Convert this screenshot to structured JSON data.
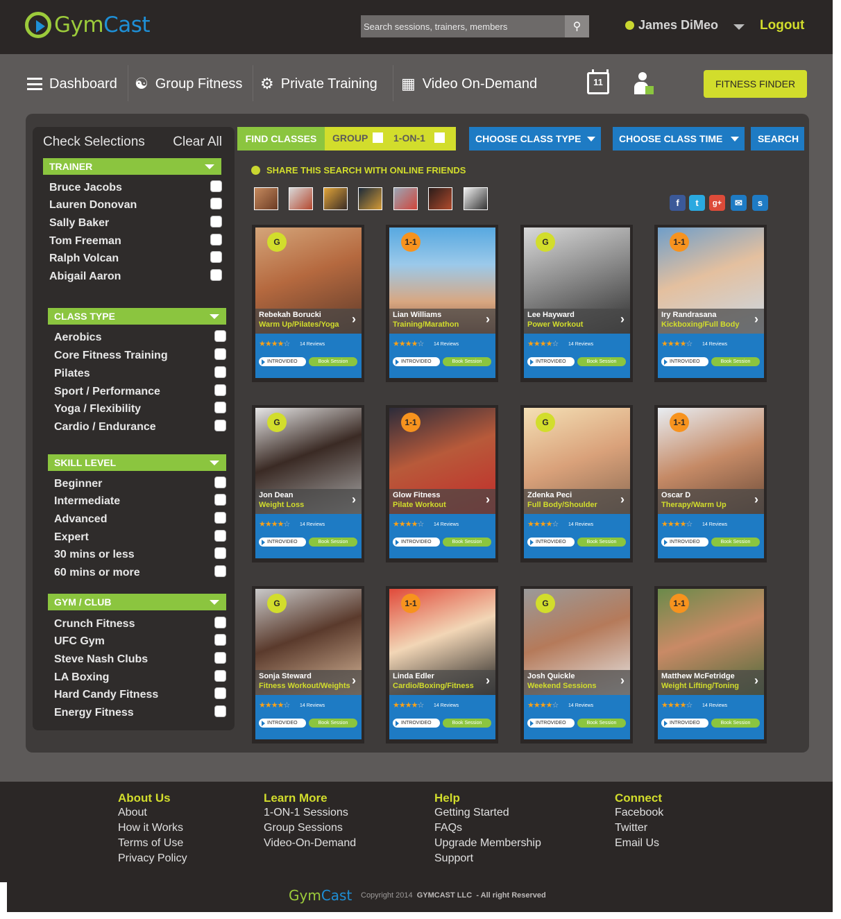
{
  "header": {
    "logo": {
      "part1": "Gym",
      "part2": "Cast"
    },
    "search_placeholder": "Search sessions, trainers, members",
    "user_name": "James DiMeo",
    "logout": "Logout"
  },
  "nav": {
    "items": [
      "Dashboard",
      "Group Fitness",
      "Private Training",
      "Video On-Demand"
    ],
    "calendar_day": "11",
    "fitness_finder": "FITNESS FINDER"
  },
  "sidebar": {
    "check_selections": "Check Selections",
    "clear_all": "Clear All",
    "sections": [
      {
        "title": "TRAINER",
        "options": [
          "Bruce Jacobs",
          "Lauren Donovan",
          "Sally Baker",
          "Tom Freeman",
          "Ralph Volcan",
          "Abigail Aaron"
        ]
      },
      {
        "title": "CLASS TYPE",
        "options": [
          "Aerobics",
          "Core Fitness Training",
          "Pilates",
          "Sport / Performance",
          "Yoga / Flexibility",
          "Cardio / Endurance"
        ]
      },
      {
        "title": "SKILL LEVEL",
        "options": [
          "Beginner",
          "Intermediate",
          "Advanced",
          "Expert",
          "30 mins or less",
          "60 mins or more"
        ]
      },
      {
        "title": "GYM / CLUB",
        "options": [
          "Crunch Fitness",
          "UFC Gym",
          "Steve Nash Clubs",
          "LA Boxing",
          "Hard Candy Fitness",
          "Energy Fitness"
        ]
      }
    ]
  },
  "toolbar": {
    "find_classes": "FIND CLASSES",
    "group": "GROUP",
    "one_on_one": "1-ON-1",
    "class_type": "CHOOSE CLASS TYPE",
    "class_time": "CHOOSE CLASS TIME",
    "search": "SEARCH"
  },
  "share": {
    "text": "SHARE THIS SEARCH WITH ONLINE FRIENDS"
  },
  "social": [
    "facebook-icon",
    "twitter-icon",
    "google-plus-icon",
    "email-icon",
    "skype-icon"
  ],
  "card_labels": {
    "reviews": "14 Reviews",
    "intro": "INTROVIDEO",
    "book": "Book Session"
  },
  "cards": [
    {
      "badge": "G",
      "name": "Rebekah Borucki",
      "class": "Warm Up/Pilates/Yoga",
      "rating": 4
    },
    {
      "badge": "1-1",
      "name": "Lian Williams",
      "class": "Training/Marathon",
      "rating": 4
    },
    {
      "badge": "G",
      "name": "Lee Hayward",
      "class": "Power Workout",
      "rating": 4
    },
    {
      "badge": "1-1",
      "name": "Iry Randrasana",
      "class": "Kickboxing/Full Body",
      "rating": 4
    },
    {
      "badge": "G",
      "name": "Jon Dean",
      "class": "Weight Loss",
      "rating": 4
    },
    {
      "badge": "1-1",
      "name": "Glow Fitness",
      "class": "Pilate Workout",
      "rating": 4
    },
    {
      "badge": "G",
      "name": "Zdenka Peci",
      "class": "Full Body/Shoulder",
      "rating": 4
    },
    {
      "badge": "1-1",
      "name": "Oscar D",
      "class": "Therapy/Warm Up",
      "rating": 4
    },
    {
      "badge": "G",
      "name": "Sonja Steward",
      "class": "Fitness Workout/Weights",
      "rating": 4
    },
    {
      "badge": "1-1",
      "name": "Linda Edler",
      "class": "Cardio/Boxing/Fitness",
      "rating": 4
    },
    {
      "badge": "G",
      "name": "Josh Quickle",
      "class": "Weekend Sessions",
      "rating": 4
    },
    {
      "badge": "1-1",
      "name": "Matthew McFetridge",
      "class": "Weight Lifting/Toning",
      "rating": 4
    }
  ],
  "footer": {
    "columns": [
      {
        "title": "About Us",
        "links": [
          "About",
          "How it Works",
          "Terms of Use",
          "Privacy Policy"
        ]
      },
      {
        "title": "Learn More",
        "links": [
          "1-ON-1 Sessions",
          "Group Sessions",
          "Video-On-Demand"
        ]
      },
      {
        "title": "Help",
        "links": [
          "Getting Started",
          "FAQs",
          "Upgrade Membership",
          "Support"
        ]
      },
      {
        "title": "Connect",
        "links": [
          "Facebook",
          "Twitter",
          "Email Us"
        ]
      }
    ],
    "copyright_prefix": "Copyright 2014",
    "copyright_company": "GYMCAST LLC",
    "copyright_suffix": "-  All right Reserved"
  },
  "colors": {
    "green": "#8bc53f",
    "yellow": "#d2dd2c",
    "blue": "#1e7bc4",
    "orange": "#f7931e",
    "dark": "#2b2726"
  }
}
